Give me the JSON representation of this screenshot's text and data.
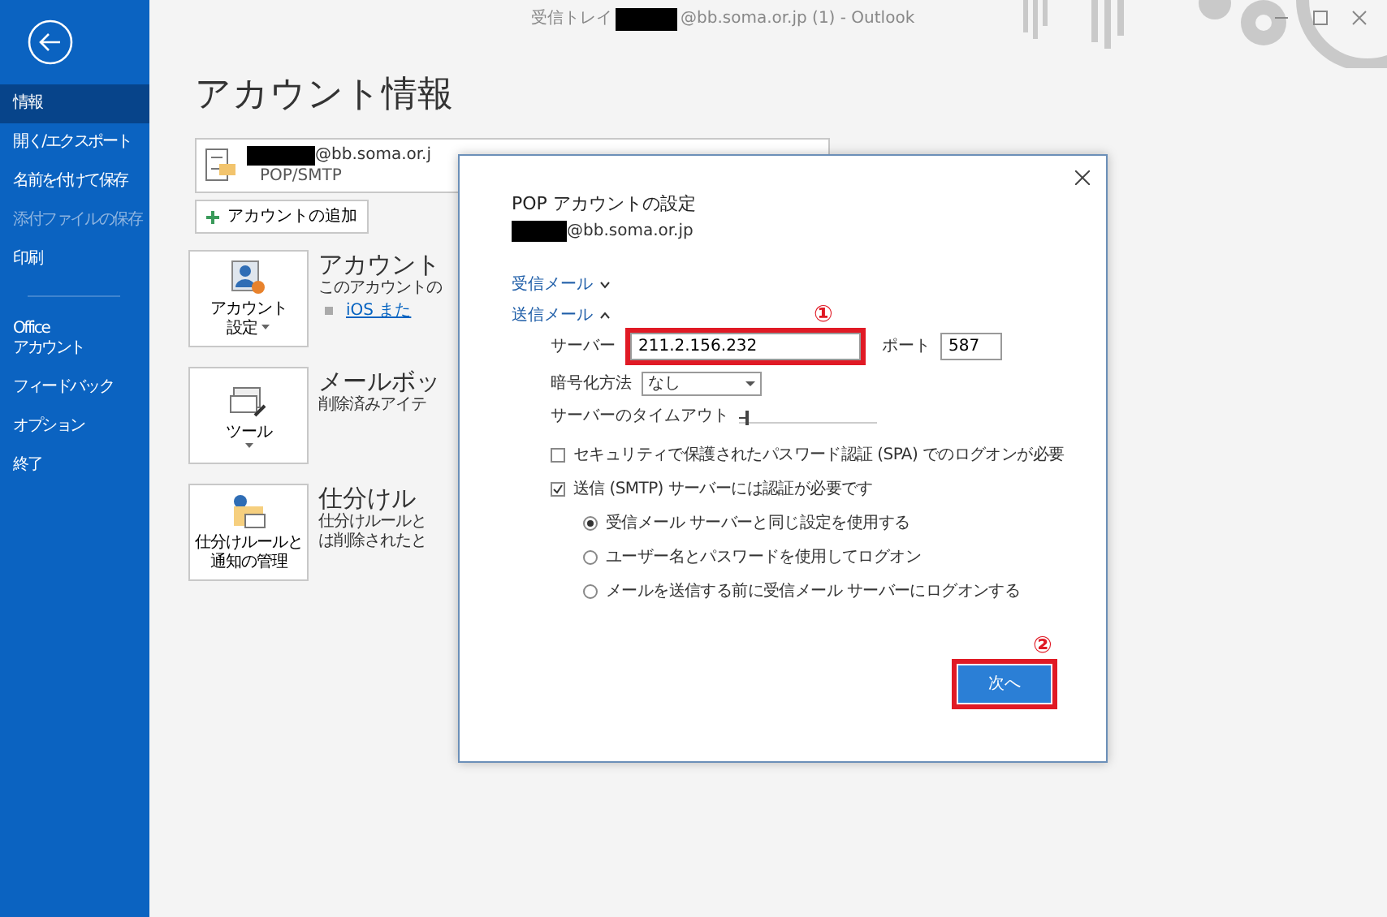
{
  "window": {
    "title_prefix": "受信トレイ",
    "title_suffix": "@bb.soma.or.jp (1)  -  Outlook"
  },
  "sidebar": {
    "groups": [
      [
        {
          "label": "情報",
          "selected": true,
          "disabled": false
        },
        {
          "label": "開く/エクスポート",
          "selected": false,
          "disabled": false
        },
        {
          "label": "名前を付けて保存",
          "selected": false,
          "disabled": false
        },
        {
          "label": "添付ファイルの保存",
          "selected": false,
          "disabled": true
        },
        {
          "label": "印刷",
          "selected": false,
          "disabled": false
        }
      ],
      [
        {
          "label": "Office\nアカウント",
          "selected": false,
          "disabled": false
        },
        {
          "label": "フィードバック",
          "selected": false,
          "disabled": false
        },
        {
          "label": "オプション",
          "selected": false,
          "disabled": false
        },
        {
          "label": "終了",
          "selected": false,
          "disabled": false
        }
      ]
    ]
  },
  "page": {
    "title": "アカウント情報",
    "account": {
      "email": "@bb.soma.or.j",
      "type": "POP/SMTP"
    },
    "add_account": "アカウントの追加",
    "sections": [
      {
        "kind": "settings",
        "button_lines": [
          "アカウント",
          "設定"
        ],
        "dropdown": true,
        "title": "アカウント",
        "lines": [
          "このアカウントの"
        ],
        "link": "iOS また"
      },
      {
        "kind": "tools",
        "button_lines": [
          "ツール"
        ],
        "dropdown": true,
        "title": "メールボッ",
        "lines": [
          "削除済みアイテ"
        ]
      },
      {
        "kind": "rules",
        "button_lines": [
          "仕分けルールと",
          "通知の管理"
        ],
        "dropdown": false,
        "title": "仕分けル",
        "lines": [
          "仕分けルールと",
          "は削除されたと"
        ]
      }
    ]
  },
  "dialog": {
    "title": "POP アカウントの設定",
    "email": "@bb.soma.or.jp",
    "sections": [
      {
        "label": "受信メール",
        "expanded": false
      },
      {
        "label": "送信メール",
        "expanded": true
      }
    ],
    "server_label": "サーバー",
    "server": "211.2.156.232",
    "port_label": "ポート",
    "port": "587",
    "encryption_label": "暗号化方法",
    "encryption": "なし",
    "timeout_label": "サーバーのタイムアウト",
    "timeout": {
      "level": 0.05
    },
    "checkboxes": [
      {
        "label": "セキュリティで保護されたパスワード認証 (SPA) でのログオンが必要",
        "checked": false
      },
      {
        "label": "送信 (SMTP) サーバーには認証が必要です",
        "checked": true
      }
    ],
    "radios": [
      {
        "label": "受信メール サーバーと同じ設定を使用する",
        "selected": true
      },
      {
        "label": "ユーザー名とパスワードを使用してログオン",
        "selected": false
      },
      {
        "label": "メールを送信する前に受信メール サーバーにログオンする",
        "selected": false
      }
    ],
    "next": "次へ"
  },
  "annotations": [
    {
      "label": "①"
    },
    {
      "label": "②"
    }
  ]
}
